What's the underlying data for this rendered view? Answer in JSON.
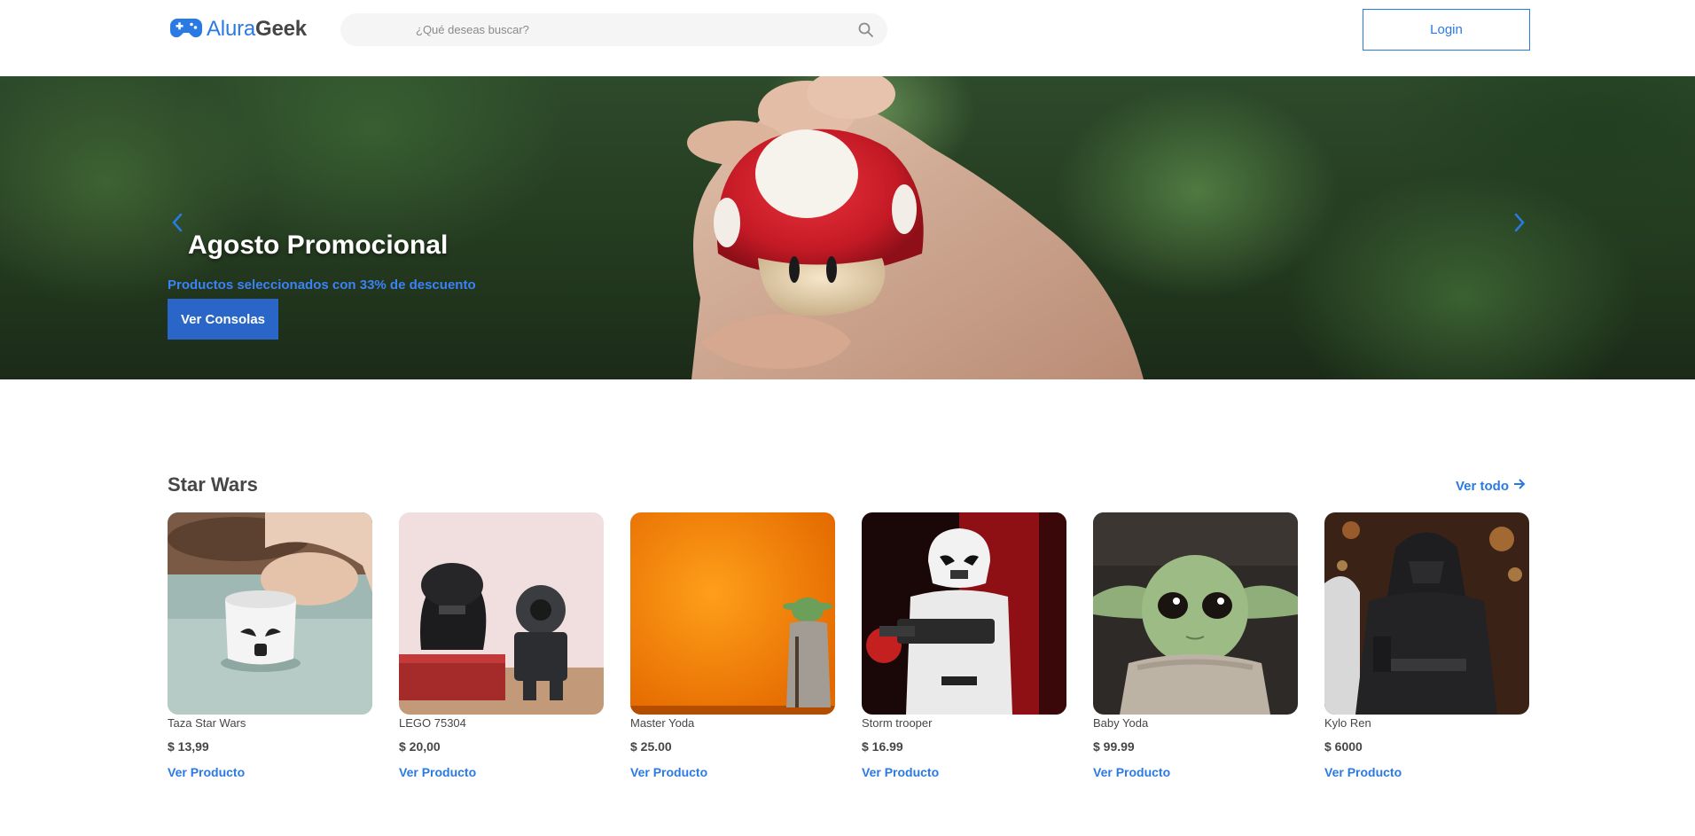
{
  "brand": {
    "name_part1": "Alura",
    "name_part2": "Geek",
    "logo_icon": "gamepad-icon",
    "accent": "#2a7ae4"
  },
  "search": {
    "placeholder": "¿Qué deseas buscar?",
    "value": ""
  },
  "header": {
    "login_label": "Login"
  },
  "banner": {
    "title": "Agosto Promocional",
    "subtitle": "Productos seleccionados con 33% de descuento",
    "button_label": "Ver Consolas"
  },
  "section": {
    "title": "Star Wars",
    "see_all_label": "Ver todo"
  },
  "products": [
    {
      "name": "Taza Star Wars",
      "price": "$ 13,99",
      "link_label": "Ver Producto"
    },
    {
      "name": "LEGO 75304",
      "price": "$ 20,00",
      "link_label": "Ver Producto"
    },
    {
      "name": "Master Yoda",
      "price": "$ 25.00",
      "link_label": "Ver Producto"
    },
    {
      "name": "Storm trooper",
      "price": "$ 16.99",
      "link_label": "Ver Producto"
    },
    {
      "name": "Baby Yoda",
      "price": "$ 99.99",
      "link_label": "Ver Producto"
    },
    {
      "name": "Kylo Ren",
      "price": "$ 6000",
      "link_label": "Ver Producto"
    }
  ]
}
